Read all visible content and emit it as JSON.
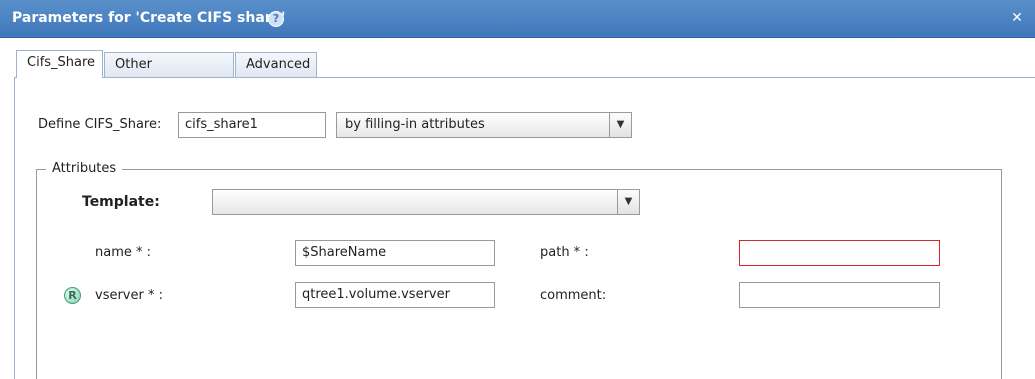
{
  "dialog": {
    "title": "Parameters for 'Create CIFS share'",
    "help_glyph": "?",
    "close_glyph": "✕"
  },
  "tabs": [
    {
      "label": "Cifs_Share",
      "active": true
    },
    {
      "label": "Other Parameters",
      "active": false
    },
    {
      "label": "Advanced",
      "active": false
    }
  ],
  "define": {
    "label": "Define CIFS_Share:",
    "name_value": "cifs_share1",
    "mode_value": "by filling-in attributes"
  },
  "attributes": {
    "legend": "Attributes",
    "template_label": "Template:",
    "template_value": "",
    "name_label": "name * :",
    "name_value": "$ShareName",
    "path_label": "path * :",
    "path_value": "",
    "vserver_label": "vserver * :",
    "vserver_value": "qtree1.volume.vserver",
    "vserver_badge": "R",
    "comment_label": "comment:",
    "comment_value": ""
  },
  "colors": {
    "titlebar": "#3f78bb",
    "error_border": "#d9262b"
  }
}
